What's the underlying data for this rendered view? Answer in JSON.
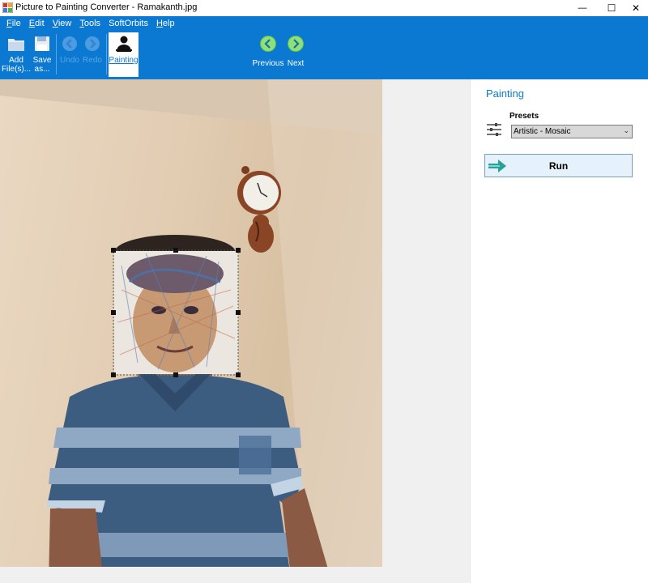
{
  "window": {
    "title": "Picture to Painting Converter - Ramakanth.jpg",
    "controls": {
      "minimize": "—",
      "maximize": "☐",
      "close": "✕"
    }
  },
  "menu": [
    {
      "label": "File",
      "mnemonic": "F",
      "rest": "ile"
    },
    {
      "label": "Edit",
      "mnemonic": "E",
      "rest": "dit"
    },
    {
      "label": "View",
      "mnemonic": "V",
      "rest": "iew"
    },
    {
      "label": "Tools",
      "mnemonic": "T",
      "rest": "ools"
    },
    {
      "label": "SoftOrbits",
      "mnemonic": "",
      "rest": "SoftOrbits"
    },
    {
      "label": "Help",
      "mnemonic": "H",
      "rest": "elp"
    }
  ],
  "toolbar": {
    "add_files": "Add\nFile(s)...",
    "save_as": "Save\nas...",
    "undo": "Undo",
    "redo": "Redo",
    "painting": "Painting",
    "previous": "Previous",
    "next": "Next"
  },
  "icons": {
    "add_files": "folder-icon",
    "save_as": "floppy-disk-icon",
    "undo": "undo-arrow-icon",
    "redo": "redo-arrow-icon",
    "painting": "person-bust-icon",
    "previous": "circle-chevron-left-icon",
    "next": "circle-chevron-right-icon",
    "presets": "sliders-icon",
    "run": "right-arrow-icon"
  },
  "panel": {
    "title": "Painting",
    "presets_label": "Presets",
    "preset_value": "Artistic - Mosaic",
    "run_label": "Run"
  },
  "colors": {
    "accent": "#0b78d1",
    "run_button_bg": "#e5f1fb",
    "run_arrow": "#2aa198"
  }
}
